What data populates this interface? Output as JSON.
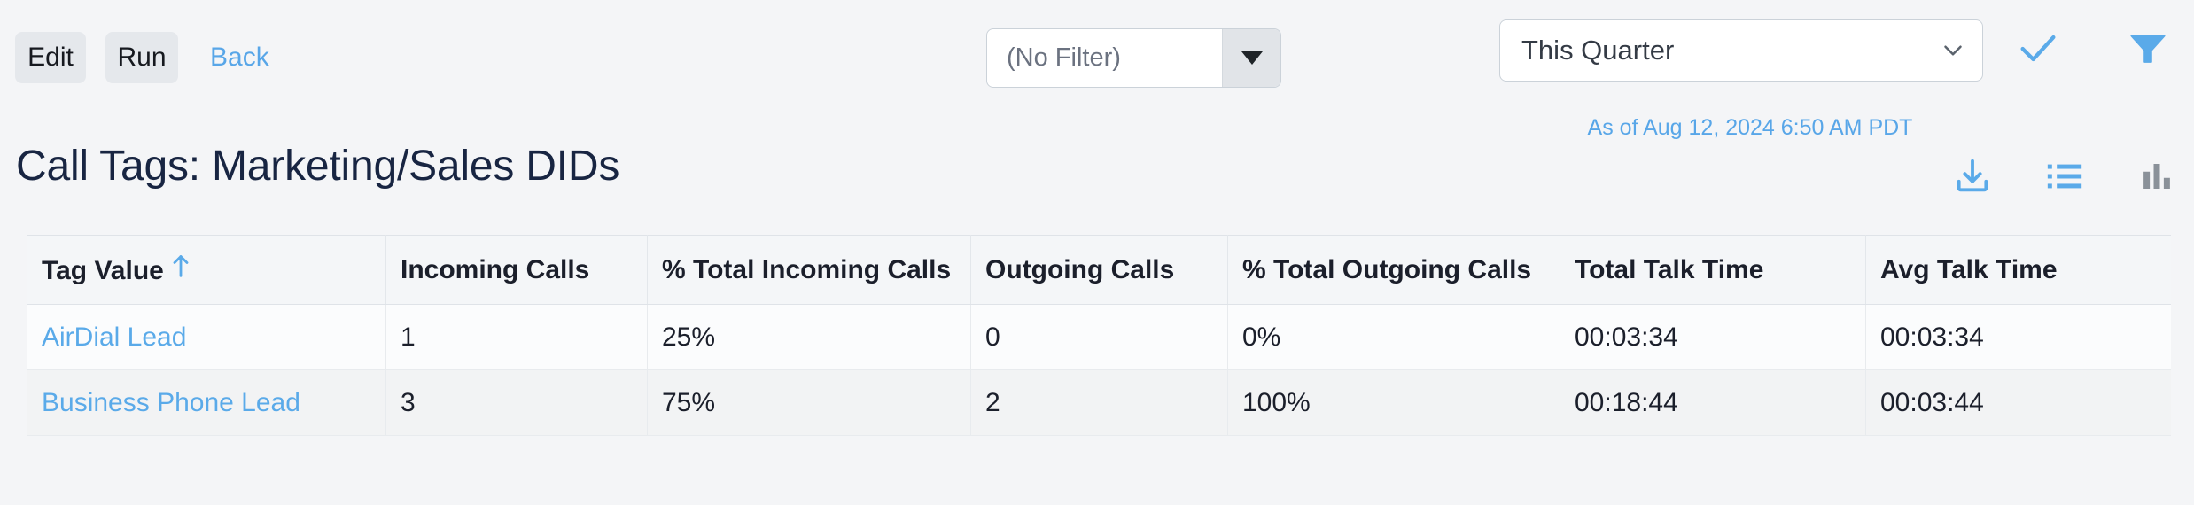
{
  "toolbar": {
    "edit_label": "Edit",
    "run_label": "Run",
    "back_label": "Back",
    "filter_value": "(No Filter)",
    "filter_caret_icon": "caret-down-icon",
    "period_value": "This Quarter",
    "period_chevron_icon": "chevron-down-icon",
    "apply_icon": "check-icon",
    "filter_icon": "funnel-icon",
    "as_of": "As of Aug 12, 2024 6:50 AM PDT"
  },
  "header": {
    "title": "Call Tags: Marketing/Sales DIDs",
    "download_icon": "download-icon",
    "list_view_icon": "list-view-icon",
    "chart_view_icon": "bar-chart-icon"
  },
  "colors": {
    "accent_blue": "#58a6e8",
    "link_blue": "#5aaae9",
    "title_navy": "#182542",
    "page_bg": "#f4f5f7",
    "button_bg": "#e5e8ec",
    "inactive_grey": "#8a9199"
  },
  "table": {
    "sort_indicator": "↑",
    "sort_column": "Tag Value",
    "columns": [
      "Tag Value",
      "Incoming Calls",
      "% Total Incoming Calls",
      "Outgoing Calls",
      "% Total Outgoing Calls",
      "Total Talk Time",
      "Avg Talk Time"
    ],
    "rows": [
      {
        "tag_value": "AirDial Lead",
        "incoming_calls": "1",
        "pct_total_incoming": "25%",
        "outgoing_calls": "0",
        "pct_total_outgoing": "0%",
        "total_talk_time": "00:03:34",
        "avg_talk_time": "00:03:34"
      },
      {
        "tag_value": "Business Phone Lead",
        "incoming_calls": "3",
        "pct_total_incoming": "75%",
        "outgoing_calls": "2",
        "pct_total_outgoing": "100%",
        "total_talk_time": "00:18:44",
        "avg_talk_time": "00:03:44"
      }
    ]
  }
}
